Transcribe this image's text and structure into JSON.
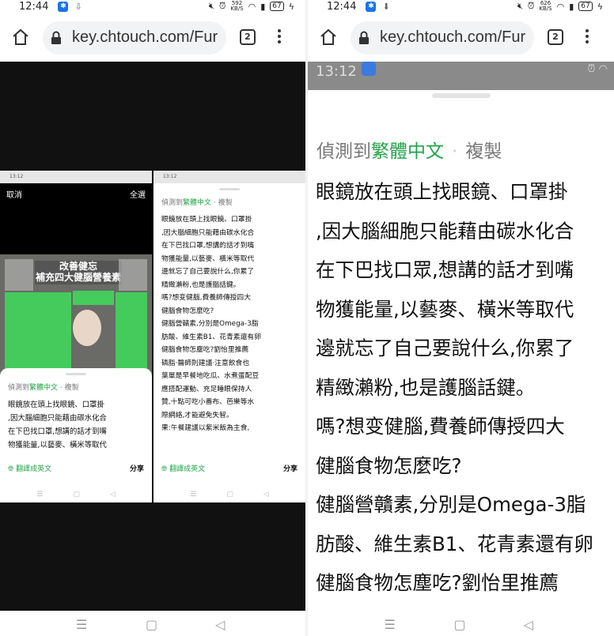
{
  "status": {
    "time": "12:44",
    "left_speed": "592\nKB/S",
    "right_speed": "626\nKB/S",
    "battery": "67"
  },
  "browser": {
    "url": "key.chtouch.com/Fur",
    "tab_count": "2"
  },
  "mockup": {
    "status_time": "13:12",
    "cancel": "取消",
    "select_all": "全選",
    "photo_title": "改善健忘\n補充四大健腦營養素",
    "detected_prefix": "偵測到",
    "detected_lang": "繁體中文",
    "copy": "複製",
    "translate": "翻譯成英文",
    "share": "分享",
    "lines_short": [
      "眼鏡放在頭上找眼鏡、口罩掛",
      ",因大腦細胞只能藉由碳水化合",
      "在下巴找口罩,想講的話才到嘴",
      "物獲能量,以藝麥、橫米等取代"
    ],
    "lines_long": [
      "眼鏡放在頭上找眼鏡、口罩掛",
      ",因大腦細胞只能藉由碳水化合",
      "在下巴找口罩,想講的話才到嘴",
      "物獲能量,以藝麥、橫米等取代",
      "邊就忘了自己要說什么,你累了",
      "精緻瀨粉,也是護腦話鍵。",
      "嗎?想变健腦,費養師傳授四大",
      "健腦食物怎麼吃?",
      "健腦營贛素,分別是Omega-3脂",
      "肪酸、維生素B1、花青素還有卵",
      "健腦食物怎塵吃?劉怡里推薦",
      "磷脂·醫師則建議·注意飲食也",
      "葉單是早餐地吃瓜、水煮蛋配豆",
      "應搭配運動、充足睡眼保持人",
      "贊,十點可吃小番布、芭樂等水",
      "際網絡,才能避免失智。",
      "果:午餐建議以紫米飯為主食,"
    ]
  },
  "zoom": {
    "status_time": "13:12",
    "detected_prefix": "偵測到",
    "detected_lang": "繁體中文",
    "separator": "·",
    "copy": "複製",
    "lines": [
      "眼鏡放在頭上找眼鏡、口罩掛",
      ",因大腦細胞只能藉由碳水化合",
      "在下巴找口眾,想講的話才到嘴",
      "物獲能量,以藝麥、橫米等取代",
      "邊就忘了自己要說什么,你累了",
      "精緻瀨粉,也是護腦話鍵。",
      "嗎?想变健腦,費養師傳授四大",
      "健腦食物怎麼吃?",
      "健腦營贛素,分別是Omega-3脂",
      "肪酸、維生素B1、花青素還有卵",
      "健腦食物怎塵吃?劉怡里推薦",
      "磷脂·醫師則建議·注意飲食也"
    ]
  }
}
